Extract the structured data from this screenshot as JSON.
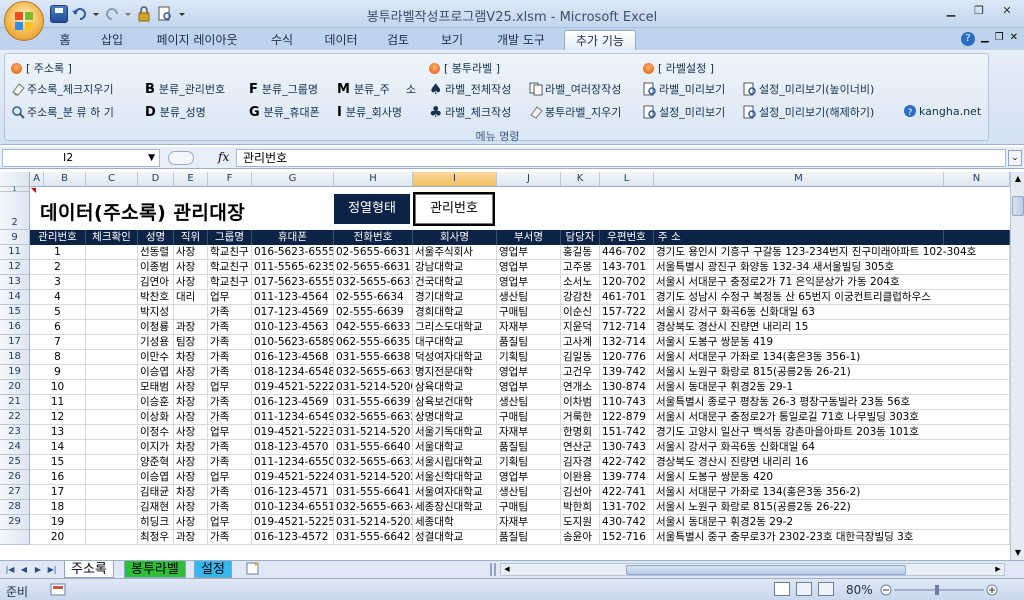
{
  "window": {
    "title": "봉투라벨작성프로그램V25.xlsm  -  Microsoft Excel"
  },
  "tabs": [
    {
      "label": "홈",
      "active": false
    },
    {
      "label": "삽입",
      "active": false
    },
    {
      "label": "페이지 레이아웃",
      "active": false
    },
    {
      "label": "수식",
      "active": false
    },
    {
      "label": "데이터",
      "active": false
    },
    {
      "label": "검토",
      "active": false
    },
    {
      "label": "보기",
      "active": false
    },
    {
      "label": "개발 도구",
      "active": false
    },
    {
      "label": "추가 기능",
      "active": true
    }
  ],
  "ribbon": {
    "group_label": "메뉴 명령",
    "section_addr": "[ 주소록 ]",
    "section_label": "[ 봉투라벨 ]",
    "section_settings": "[ 라벨설정 ]",
    "addr_check": "주소록_체크지우기",
    "addr_sort": "주소록_분 류 하 기",
    "cat_mgmt": "분류_관리번호",
    "cat_name": "분류_성명",
    "cat_group": "분류_그룹명",
    "cat_phone": "분류_휴대폰",
    "cat_addr": "분류_주",
    "cat_addr2": "소",
    "cat_company": "분류_회사명",
    "label_all": "라벨_전체작성",
    "label_multi": "라벨_여러장작성",
    "label_check": "라벨_체크작성",
    "label_clear": "봉투라벨_지우기",
    "label_preview": "라벨_미리보기",
    "settings_preview": "설정_미리보기",
    "settings_preview_wh": "설정_미리보기(높이너비)",
    "settings_preview_off": "설정_미리보기(해제하기)",
    "kangha": "kangha.net",
    "letters": {
      "b": "B",
      "d": "D",
      "f": "F",
      "g": "G",
      "m": "M",
      "i": "I"
    }
  },
  "formula_bar": {
    "name_box": "I2",
    "fx": "fx",
    "value": "관리번호"
  },
  "columns": [
    "A",
    "B",
    "C",
    "D",
    "E",
    "F",
    "G",
    "H",
    "I",
    "J",
    "K",
    "L",
    "M",
    "N"
  ],
  "sheet": {
    "title": "데이터(주소록) 관리대장",
    "sort_button": "정열형태",
    "mgmt_button": "관리번호",
    "headers": [
      "관리번호",
      "체크확인",
      "성명",
      "직위",
      "그룹명",
      "휴대폰",
      "전화번호",
      "회사명",
      "부서명",
      "담당자",
      "우편번호",
      "주    소"
    ],
    "row_numbers": [
      "1",
      "2",
      "9",
      "11",
      "12",
      "13",
      "14",
      "15",
      "16",
      "17",
      "18",
      "19",
      "20",
      "21",
      "22",
      "23",
      "24",
      "25",
      "26",
      "27",
      "28",
      "29"
    ],
    "rows": [
      [
        "1",
        "",
        "선동렬",
        "사장",
        "학교친구",
        "016-5623-6555",
        "02-5655-6631",
        "서울주식회사",
        "영업부",
        "홍길동",
        "446-702",
        "경기도 용인시 기흥구 구갈동 123-234번지 진구미래아파트 102-304호"
      ],
      [
        "2",
        "",
        "이종범",
        "사장",
        "학교친구",
        "011-5565-6235",
        "02-5655-6631",
        "강남대학교",
        "영업부",
        "고주몽",
        "143-701",
        "서울특별시 광진구 화양동 132-34 새서울빌딩 305호"
      ],
      [
        "3",
        "",
        "김연아",
        "사장",
        "학교친구",
        "017-5623-6555",
        "032-5655-6631",
        "건국대학교",
        "영업부",
        "소서노",
        "120-702",
        "서울시 서대문구 충정로2가 71 은익문상가 가동 204호"
      ],
      [
        "4",
        "",
        "박찬호",
        "대리",
        "업무",
        "011-123-4564",
        "02-555-6634",
        "경기대학교",
        "생산팀",
        "강감찬",
        "461-701",
        "경기도 성남시 수정구 복정동 산 65번지 이궁컨트리클럽하우스"
      ],
      [
        "5",
        "",
        "박지성",
        "",
        "가족",
        "017-123-4569",
        "02-555-6639",
        "경희대학교",
        "구매팀",
        "이순신",
        "157-722",
        "서울시 강서구 화곡6동 신화대일 63"
      ],
      [
        "6",
        "",
        "이청룡",
        "과장",
        "가족",
        "010-123-4563",
        "042-555-6633",
        "그리스도대학교",
        "자재부",
        "지윤덕",
        "712-714",
        "경상북도 경산시 진량면 내리리 15"
      ],
      [
        "7",
        "",
        "기성용",
        "팀장",
        "가족",
        "010-5623-6589",
        "062-555-6635",
        "대구대학교",
        "품질팀",
        "고사계",
        "132-714",
        "서울시 도봉구 쌍문동 419"
      ],
      [
        "8",
        "",
        "이만수",
        "차장",
        "가족",
        "016-123-4568",
        "031-555-6638",
        "덕성여자대학교",
        "기획팀",
        "김일동",
        "120-776",
        "서울시 서대문구 가좌로 134(홍은3동 356-1)"
      ],
      [
        "9",
        "",
        "이승엽",
        "사장",
        "가족",
        "018-1234-6548",
        "032-5655-6631",
        "명지전문대학",
        "영업부",
        "고건우",
        "139-742",
        "서울시 노원구 화랑로 815(공릉2동 26-21)"
      ],
      [
        "10",
        "",
        "모태범",
        "사장",
        "업무",
        "019-4521-5222",
        "031-5214-5200",
        "삼육대학교",
        "영업부",
        "연개소",
        "130-874",
        "서울시 동대문구 휘경2동 29-1"
      ],
      [
        "11",
        "",
        "이승훈",
        "차장",
        "가족",
        "016-123-4569",
        "031-555-6639",
        "삼육보건대학",
        "생산팀",
        "이차범",
        "110-743",
        "서울특별시 종로구 평창동 26-3 평창구동빌라 23동 56호"
      ],
      [
        "12",
        "",
        "이상화",
        "사장",
        "가족",
        "011-1234-6549",
        "032-5655-6632",
        "상명대학교",
        "구매팀",
        "거룩한",
        "122-879",
        "서울시 서대문구 충정로2가 통일로길 71호 나무빌딩 303호"
      ],
      [
        "13",
        "",
        "이정수",
        "사장",
        "업무",
        "019-4521-5223",
        "031-5214-5201",
        "서울기독대학교",
        "자재부",
        "한명회",
        "151-742",
        "경기도 고양시 일산구 백석동 강촌마을아파트 203동 101호"
      ],
      [
        "14",
        "",
        "이지가",
        "차장",
        "가족",
        "018-123-4570",
        "031-555-6640",
        "서울대학교",
        "품질팀",
        "연산군",
        "130-743",
        "서울시 강서구 화곡6동 신화대일 64"
      ],
      [
        "15",
        "",
        "양준혁",
        "사장",
        "가족",
        "011-1234-6550",
        "032-5655-6633",
        "서울시립대학교",
        "기획팀",
        "김자경",
        "422-742",
        "경상북도 경산시 진량면 내리리 16"
      ],
      [
        "16",
        "",
        "이승엽",
        "사장",
        "업무",
        "019-4521-5224",
        "031-5214-5202",
        "서울신학대학교",
        "영업부",
        "이완용",
        "139-774",
        "서울시 도봉구 쌍문동 420"
      ],
      [
        "17",
        "",
        "김태균",
        "차장",
        "가족",
        "016-123-4571",
        "031-555-6641",
        "서울여자대학교",
        "생산팀",
        "김선아",
        "422-741",
        "서울시 서대문구 가좌로 134(홍은3동 356-2)"
      ],
      [
        "18",
        "",
        "김재현",
        "사장",
        "가족",
        "010-1234-6551",
        "032-5655-6634",
        "세종장신대학교",
        "구매팀",
        "박한희",
        "131-702",
        "서울시 노원구 화랑로 815(공릉2동 26-22)"
      ],
      [
        "19",
        "",
        "히딩크",
        "사장",
        "업무",
        "019-4521-5225",
        "031-5214-5203",
        "세종대학",
        "자재부",
        "도지원",
        "430-742",
        "서울시 동대문구 휘경2동 29-2"
      ],
      [
        "20",
        "",
        "최정우",
        "과장",
        "가족",
        "016-123-4572",
        "031-555-6642",
        "성결대학교",
        "품질팀",
        "송윤아",
        "152-716",
        "서울특별시 중구 충무로3가 2302-23호 대한극장빌딩 3호"
      ]
    ]
  },
  "sheet_tabs": [
    {
      "label": "주소록",
      "active": true,
      "color": "#ffffff"
    },
    {
      "label": "봉투라벨",
      "active": false,
      "color": "#2dbf37"
    },
    {
      "label": "설정",
      "active": false,
      "color": "#35b7f0"
    }
  ],
  "status": {
    "ready": "준비",
    "zoom": "80%"
  },
  "colors": {
    "header_bg": "#0c2347",
    "accent": "#bfd3ec"
  }
}
